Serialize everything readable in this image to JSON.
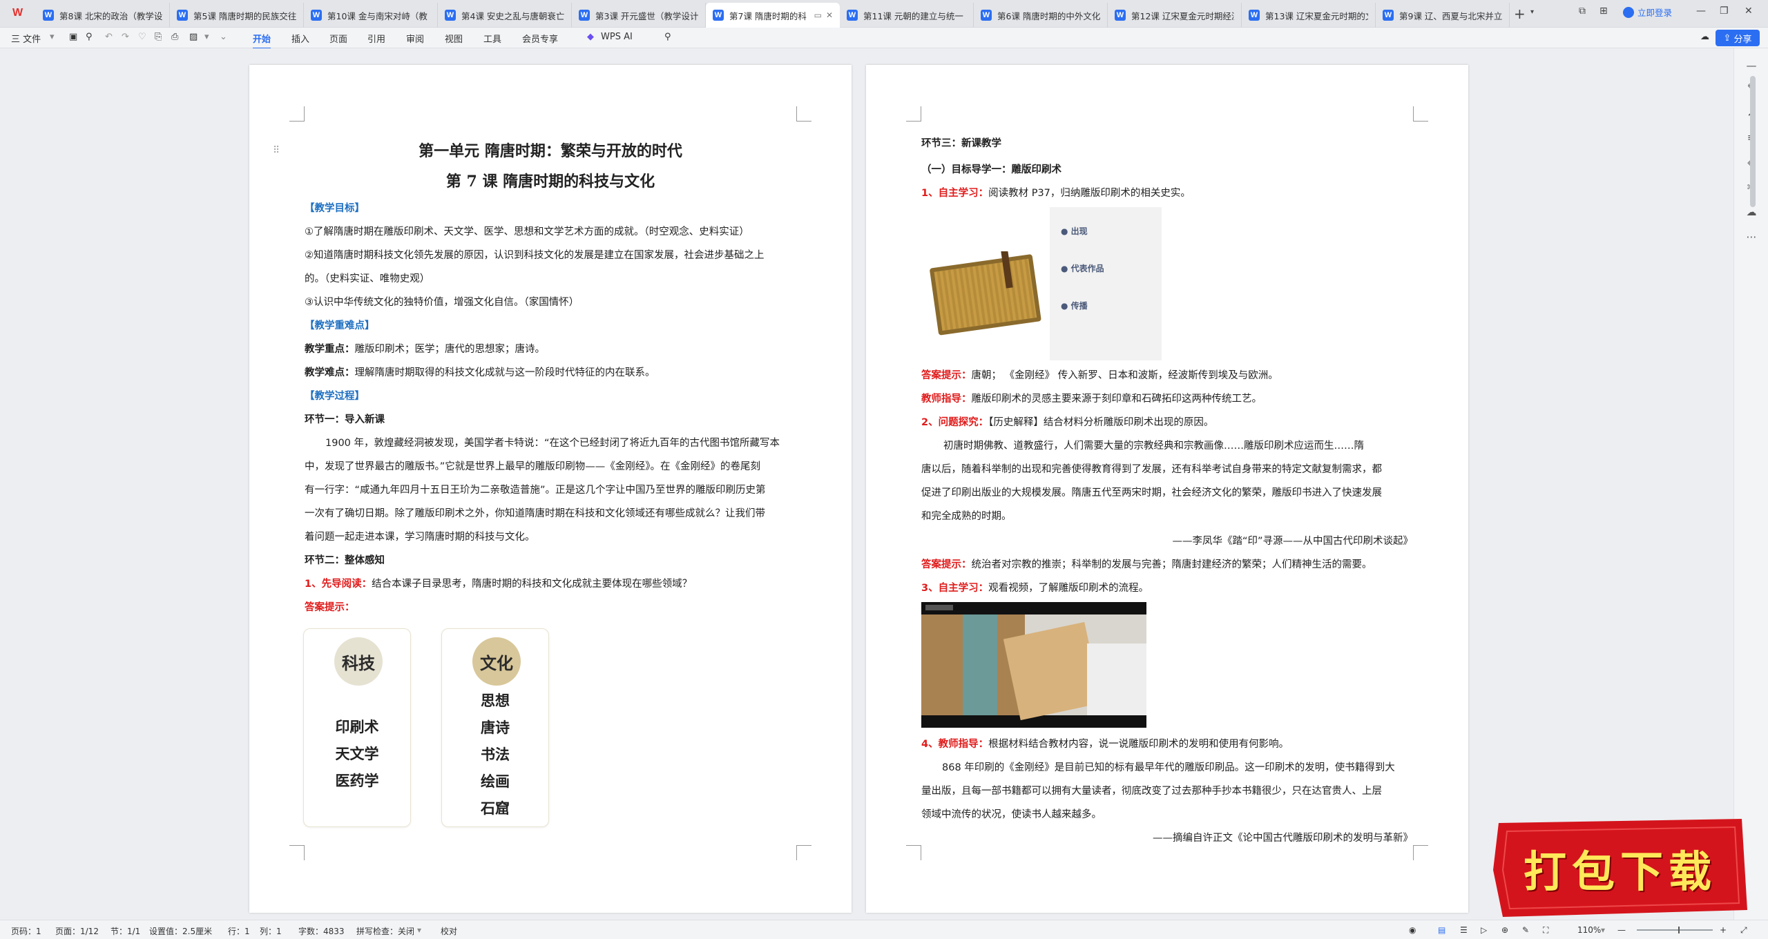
{
  "app": {
    "logo": "W"
  },
  "tabs": [
    {
      "title": "第8课 北宋的政治（教学设计",
      "active": false
    },
    {
      "title": "第5课 隋唐时期的民族交往",
      "active": false
    },
    {
      "title": "第10课 金与南宋对峙（教",
      "active": false
    },
    {
      "title": "第4课 安史之乱与唐朝衰亡",
      "active": false
    },
    {
      "title": "第3课 开元盛世（教学设计",
      "active": false
    },
    {
      "title": "第7课 隋唐时期的科",
      "active": true
    },
    {
      "title": "第11课 元朝的建立与统一（",
      "active": false
    },
    {
      "title": "第6课 隋唐时期的中外文化",
      "active": false
    },
    {
      "title": "第12课 辽宋夏金元时期经济",
      "active": false
    },
    {
      "title": "第13课 辽宋夏金元时期的文",
      "active": false
    },
    {
      "title": "第9课 辽、西夏与北宋并立",
      "active": false
    }
  ],
  "titlebar": {
    "login": "立即登录"
  },
  "toolbar": {
    "file": "三 文件",
    "menus": [
      "开始",
      "插入",
      "页面",
      "引用",
      "审阅",
      "视图",
      "工具",
      "会员专享"
    ],
    "wps_ai": "WPS AI",
    "share": "分享"
  },
  "page1": {
    "unit_title": "第一单元  隋唐时期：繁荣与开放的时代",
    "lesson_title": "第 7 课    隋唐时期的科技与文化",
    "h_goals": "【教学目标】",
    "goal1": "①了解隋唐时期在雕版印刷术、天文学、医学、思想和文学艺术方面的成就。（时空观念、史料实证）",
    "goal2a": "②知道隋唐时期科技文化领先发展的原因，认识到科技文化的发展是建立在国家发展，社会进步基础之上",
    "goal2b": "的。（史料实证、唯物史观）",
    "goal3": "③认识中华传统文化的独特价值，增强文化自信。（家国情怀）",
    "h_key": "【教学重难点】",
    "key_label": "教学重点：",
    "key_text": "雕版印刷术；医学；唐代的思想家；唐诗。",
    "diff_label": "教学难点：",
    "diff_text": "理解隋唐时期取得的科技文化成就与这一阶段时代特征的内在联系。",
    "h_process": "【教学过程】",
    "step1": "环节一：导入新课",
    "intro1": "1900 年，敦煌藏经洞被发现，美国学者卡特说：“在这个已经封闭了将近九百年的古代图书馆所藏写本",
    "intro2": "中，发现了世界最古的雕版书。”它就是世界上最早的雕版印刷物——《金刚经》。在《金刚经》的卷尾刻",
    "intro3": "有一行字：“咸通九年四月十五日王玠为二亲敬造普施”。正是这几个字让中国乃至世界的雕版印刷历史第",
    "intro4": "一次有了确切日期。除了雕版印刷术之外，你知道隋唐时期在科技和文化领域还有哪些成就么？让我们带",
    "intro5": "着问题一起走进本课，学习隋唐时期的科技与文化。",
    "step2": "环节二：整体感知",
    "q1_label": "1、先导阅读：",
    "q1_text": "结合本课子目录思考，隋唐时期的科技和文化成就主要体现在哪些领域？",
    "ans_label": "答案提示：",
    "card_sci": {
      "title": "科技",
      "items": [
        "印刷术",
        "天文学",
        "医药学"
      ]
    },
    "card_cul": {
      "title": "文化",
      "items": [
        "思想",
        "唐诗",
        "书法",
        "绘画",
        "石窟"
      ]
    }
  },
  "page2": {
    "step3": "环节三：新课教学",
    "sec1": "（一）目标导学一：雕版印刷术",
    "q1_label": "1、自主学习：",
    "q1_text": "阅读教材 P37，归纳雕版印刷术的相关史实。",
    "bullets": [
      "出现",
      "代表作品",
      "传播"
    ],
    "a1_label": "答案提示：",
    "a1_text": "唐朝；    《金刚经》        传入新罗、日本和波斯，经波斯传到埃及与欧洲。",
    "t1_label": "教师指导：",
    "t1_text": "雕版印刷术的灵感主要来源于刻印章和石碑拓印这两种传统工艺。",
    "q2_label": "2、问题探究：",
    "q2_text": "【历史解释】结合材料分析雕版印刷术出现的原因。",
    "m1": "初唐时期佛教、道教盛行，人们需要大量的宗教经典和宗教画像……雕版印刷术应运而生……隋",
    "m2": "唐以后，随着科举制的出现和完善使得教育得到了发展，还有科举考试自身带来的特定文献复制需求，都",
    "m3": "促进了印刷出版业的大规模发展。隋唐五代至两宋时期，社会经济文化的繁荣，雕版印书进入了快速发展",
    "m4": "和完全成熟的时期。",
    "src1": "——李凤华《踏“印”寻源——从中国古代印刷术谈起》",
    "a2_label": "答案提示：",
    "a2_text": "统治者对宗教的推崇；科举制的发展与完善；隋唐封建经济的繁荣；人们精神生活的需要。",
    "q3_label": "3、自主学习：",
    "q3_text": "观看视频，了解雕版印刷术的流程。",
    "q4_label": "4、教师指导：",
    "q4_text": "根据材料结合教材内容，说一说雕版印刷术的发明和使用有何影响。",
    "m5": "868 年印刷的《金刚经》是目前已知的标有最早年代的雕版印刷品。这一印刷术的发明，使书籍得到大",
    "m6": "量出版，且每一部书籍都可以拥有大量读者，彻底改变了过去那种手抄本书籍很少，只在达官贵人、上层",
    "m7": "领域中流传的状况，使读书人越来越多。",
    "src2": "——摘编自许正文《论中国古代雕版印刷术的发明与革新》"
  },
  "statusbar": {
    "page_num": "页码：1",
    "pages": "页面：1/12",
    "section": "节：1/1",
    "setting": "设置值：2.5厘米",
    "row": "行：1",
    "col": "列：1",
    "words": "字数：4833",
    "spell": "拼写检查：关闭",
    "proof": "校对",
    "zoom": "110%"
  },
  "promo": {
    "text": "打包下载"
  },
  "colors": {
    "accent": "#2b6ef2",
    "heading_blue": "#1d6fc1",
    "answer_red": "#e01b1b",
    "promo_red": "#d4141c",
    "promo_yellow": "#ffe95a"
  }
}
